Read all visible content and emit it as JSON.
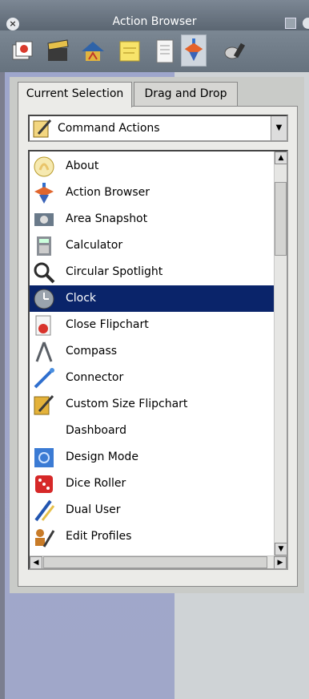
{
  "window": {
    "title": "Action Browser"
  },
  "toolbar": {
    "icons": [
      "flipchart-stack-icon",
      "clapperboard-icon",
      "house-icon",
      "sticky-note-icon",
      "page-icon",
      "spinning-top-icon",
      "tools-icon"
    ],
    "selected_index": 5
  },
  "tabs": [
    {
      "label": "Current Selection",
      "active": true
    },
    {
      "label": "Drag and Drop",
      "active": false
    }
  ],
  "dropdown": {
    "selected": "Command Actions",
    "icon": "flipchart-pen-icon"
  },
  "list": {
    "items": [
      {
        "label": "About",
        "icon": "about-icon",
        "color": "#e9c46a"
      },
      {
        "label": "Action Browser",
        "icon": "spinning-top-icon",
        "color": "#e0662e"
      },
      {
        "label": "Area Snapshot",
        "icon": "camera-icon",
        "color": "#6a7a8a"
      },
      {
        "label": "Calculator",
        "icon": "calculator-icon",
        "color": "#8a8f96"
      },
      {
        "label": "Circular Spotlight",
        "icon": "spotlight-icon",
        "color": "#2c2c2c"
      },
      {
        "label": "Clock",
        "icon": "clock-icon",
        "color": "#9aa3ad"
      },
      {
        "label": "Close Flipchart",
        "icon": "close-flipchart-icon",
        "color": "#d8332b"
      },
      {
        "label": "Compass",
        "icon": "compass-icon",
        "color": "#5a5f66"
      },
      {
        "label": "Connector",
        "icon": "connector-icon",
        "color": "#2f6fce"
      },
      {
        "label": "Custom Size Flipchart",
        "icon": "flipchart-pen-icon",
        "color": "#e4b23a"
      },
      {
        "label": "Dashboard",
        "icon": "",
        "color": ""
      },
      {
        "label": "Design Mode",
        "icon": "design-mode-icon",
        "color": "#3b7bd4"
      },
      {
        "label": "Dice Roller",
        "icon": "dice-icon",
        "color": "#d62828"
      },
      {
        "label": "Dual User",
        "icon": "dual-pen-icon",
        "color": "#2255b0"
      },
      {
        "label": "Edit Profiles",
        "icon": "edit-profiles-icon",
        "color": "#c87b28"
      }
    ],
    "selected_index": 5
  },
  "scroll": {
    "up": "▲",
    "down": "▼",
    "left": "◀",
    "right": "▶"
  },
  "colors": {
    "selection": "#0a246a",
    "titlebar": "#6b7683",
    "left_pane": "#a0a7c9"
  }
}
